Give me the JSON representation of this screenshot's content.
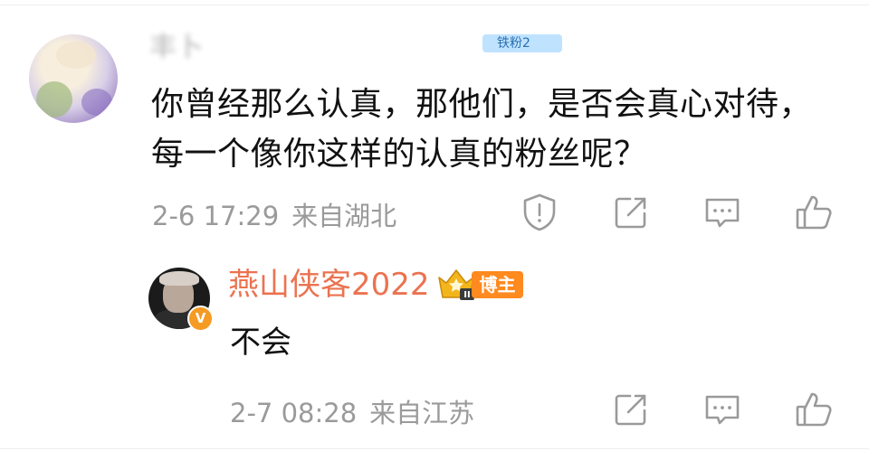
{
  "main_comment": {
    "username": "丰卜",
    "fan_badge": "铁粉2",
    "text_lines": [
      "你曾经那么认真，那他们，是否会真心对待，",
      "每一个像你这样的认真的粉丝呢？"
    ],
    "time": "2-6 17:29",
    "location": "来自湖北",
    "actions": [
      "report-icon",
      "share-icon",
      "comment-icon",
      "like-icon"
    ]
  },
  "reply": {
    "username": "燕山侠客2022",
    "verified_mark": "V",
    "level_mark": "II",
    "role_badge": "博主",
    "text": "不会",
    "time": "2-7 08:28",
    "location": "来自江苏",
    "actions": [
      "share-icon",
      "comment-icon",
      "like-icon"
    ]
  },
  "colors": {
    "username_accent": "#eb7350",
    "meta_gray": "#9a9a9a",
    "blogger_badge": "#ff8a1f",
    "crown_gold": "#f2b51c",
    "fan_badge": "#bfe3ff"
  }
}
